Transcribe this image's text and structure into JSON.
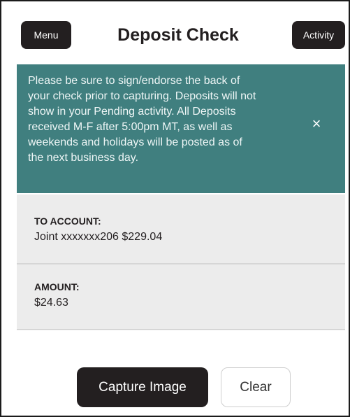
{
  "header": {
    "menu_label": "Menu",
    "title": "Deposit Check",
    "activity_label": "Activity"
  },
  "notice": {
    "lines": [
      "Please be sure to sign/endorse the back of",
      "your check prior to capturing. Deposits will not",
      "show in your Pending activity. All Deposits",
      "received M-F after 5:00pm MT, as well as",
      "weekends and holidays will be posted as of",
      "the next business day."
    ],
    "close_glyph": "×",
    "background_color": "#407f7f"
  },
  "to_account": {
    "label": "TO ACCOUNT:",
    "value": "Joint xxxxxxx206 $229.04"
  },
  "amount": {
    "label": "AMOUNT:",
    "value": "$24.63"
  },
  "actions": {
    "capture_label": "Capture Image",
    "clear_label": "Clear"
  }
}
